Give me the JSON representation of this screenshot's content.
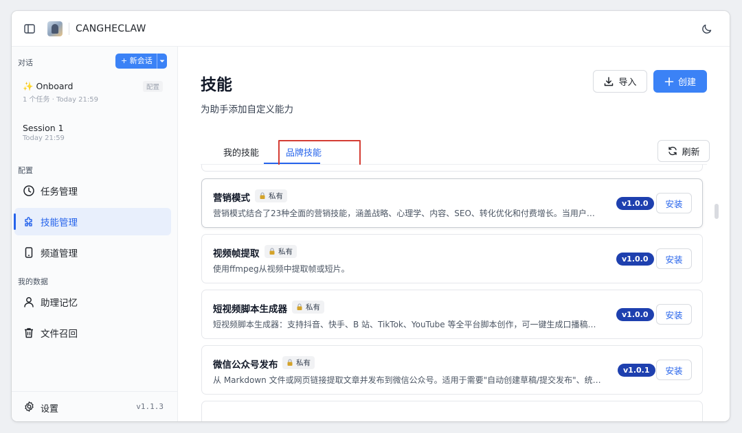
{
  "app": {
    "title": "CANGHECLAW"
  },
  "sidebar": {
    "conversations_label": "对话",
    "new_chat_label": "+ 新会话",
    "conversations": [
      {
        "title": "✨ Onboard",
        "subtitle": "1 个任务 · Today 21:59",
        "badge": "配置"
      },
      {
        "title": "Session 1",
        "subtitle": "Today 21:59"
      }
    ],
    "config_label": "配置",
    "config_items": [
      {
        "label": "任务管理",
        "icon": "clock-icon"
      },
      {
        "label": "技能管理",
        "icon": "puzzle-icon",
        "active": true
      },
      {
        "label": "频道管理",
        "icon": "phone-icon"
      }
    ],
    "data_label": "我的数据",
    "data_items": [
      {
        "label": "助理记忆",
        "icon": "user-icon"
      },
      {
        "label": "文件召回",
        "icon": "trash-icon"
      }
    ],
    "settings_label": "设置",
    "version": "v1.1.3"
  },
  "main": {
    "title": "技能",
    "subtitle": "为助手添加自定义能力",
    "import_label": "导入",
    "create_label": "创建",
    "tabs": [
      {
        "label": "我的技能"
      },
      {
        "label": "品牌技能",
        "active": true
      }
    ],
    "refresh_label": "刷新",
    "private_label": "私有",
    "install_label": "安装",
    "skills": [
      {
        "name": "营销模式",
        "description": "营销模式结合了23种全面的营销技能，涵盖战略、心理学、内容、SEO、转化优化和付费增长。当用户…",
        "version": "v1.0.0"
      },
      {
        "name": "视频帧提取",
        "description": "使用ffmpeg从视频中提取帧或短片。",
        "version": "v1.0.0"
      },
      {
        "name": "短视频脚本生成器",
        "description": "短视频脚本生成器：支持抖音、快手、B 站、TikTok、YouTube 等全平台脚本创作，可一键生成口播稿…",
        "version": "v1.0.0"
      },
      {
        "name": "微信公众号发布",
        "description": "从 Markdown 文件或网页链接提取文章并发布到微信公众号。适用于需要\"自动创建草稿/提交发布\"、统…",
        "version": "v1.0.1"
      }
    ]
  },
  "colors": {
    "accent": "#3b82f6",
    "version_pill": "#1e40af",
    "highlight_box": "#d43c33"
  }
}
